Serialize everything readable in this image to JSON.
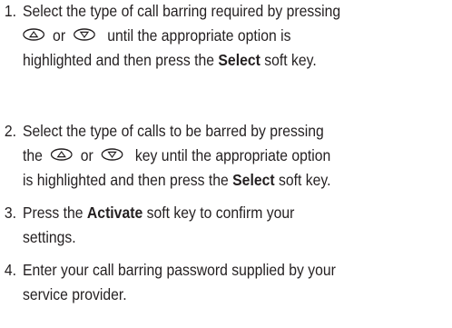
{
  "steps": [
    {
      "number": "1.",
      "line1_a": "Select the type of call barring required by pressing",
      "line2_or": "or",
      "line2_b": "until the appropriate option is",
      "line3_a": "highlighted and then press the",
      "line3_bold": "Select",
      "line3_b": "soft key."
    },
    {
      "number": "2.",
      "line1_a": "Select the type of calls to be barred by pressing",
      "line2_a": "the",
      "line2_or": "or",
      "line2_b": "key until the appropriate option",
      "line3_a": "is highlighted and then press the",
      "line3_bold": "Select",
      "line3_b": "soft key."
    },
    {
      "number": "3.",
      "line1_a": "Press the",
      "line1_bold": "Activate",
      "line1_b": "soft key to confirm your",
      "line2_a": "settings."
    },
    {
      "number": "4.",
      "line1_a": "Enter your call barring password supplied by your",
      "line2_a": "service provider."
    }
  ],
  "icons": {
    "up": "up-navigation-key-icon",
    "down": "down-navigation-key-icon"
  }
}
